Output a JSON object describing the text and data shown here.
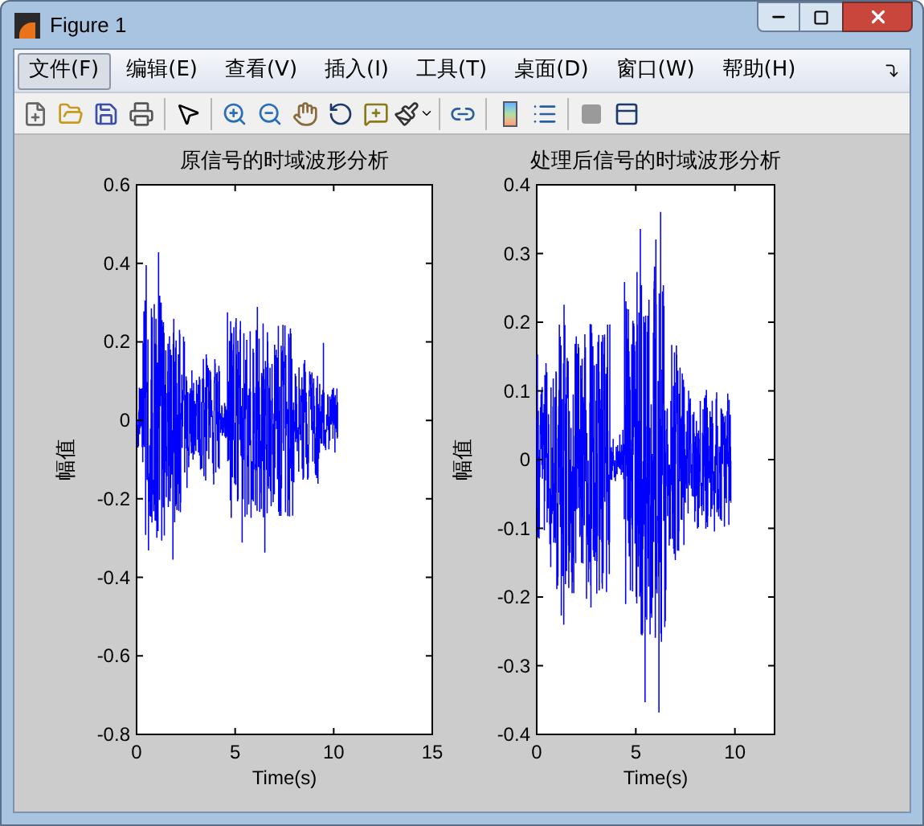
{
  "window": {
    "title": "Figure 1"
  },
  "menu": [
    {
      "label": "文件(F)",
      "selected": true
    },
    {
      "label": "编辑(E)",
      "selected": false
    },
    {
      "label": "查看(V)",
      "selected": false
    },
    {
      "label": "插入(I)",
      "selected": false
    },
    {
      "label": "工具(T)",
      "selected": false
    },
    {
      "label": "桌面(D)",
      "selected": false
    },
    {
      "label": "窗口(W)",
      "selected": false
    },
    {
      "label": "帮助(H)",
      "selected": false
    }
  ],
  "plots": [
    {
      "chart_data": {
        "type": "line",
        "title": "原信号的时域波形分析",
        "xlabel": "Time(s)",
        "ylabel": "幅值",
        "xlim": [
          0,
          15
        ],
        "ylim": [
          -0.8,
          0.6
        ],
        "xticks": [
          0,
          5,
          10,
          15
        ],
        "yticks": [
          -0.8,
          -0.6,
          -0.4,
          -0.2,
          0,
          0.2,
          0.4,
          0.6
        ]
      }
    },
    {
      "chart_data": {
        "type": "line",
        "title": "处理后信号的时域波形分析",
        "xlabel": "Time(s)",
        "ylabel": "幅值",
        "xlim": [
          0,
          12
        ],
        "ylim": [
          -0.4,
          0.4
        ],
        "xticks": [
          0,
          5,
          10
        ],
        "yticks": [
          -0.4,
          -0.3,
          -0.2,
          -0.1,
          0,
          0.1,
          0.2,
          0.3,
          0.4
        ]
      }
    }
  ]
}
